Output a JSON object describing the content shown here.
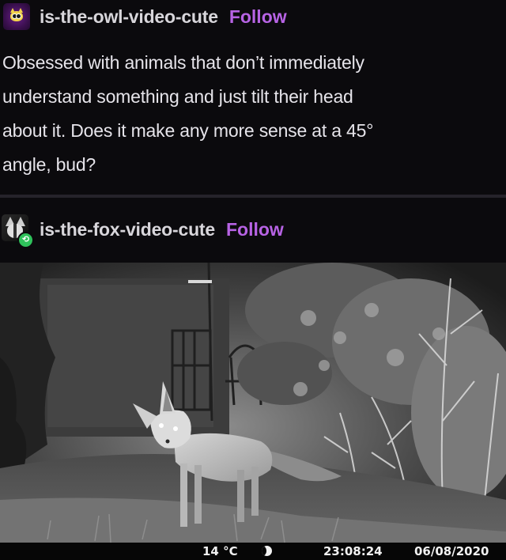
{
  "post1": {
    "blog_name": "is-the-owl-video-cute",
    "follow_label": "Follow",
    "avatar_icon": "owl-avatar-icon",
    "body_lines": [
      "Obsessed with animals that don’t immediately",
      "understand something and just tilt their head",
      "about it. Does it make any more sense at a 45°",
      "angle, bud?"
    ]
  },
  "post2": {
    "blog_name": "is-the-fox-video-cute",
    "follow_label": "Follow",
    "avatar_icon": "fox-avatar-icon",
    "badge_icon": "reblog-icon"
  },
  "photo": {
    "temperature": "14 °C",
    "moon_icon": "moon-phase-icon",
    "time": "23:08:24",
    "date": "06/08/2020"
  },
  "colors": {
    "background": "#0b0a0d",
    "follow": "#b763e4",
    "text": "#e6e4ea",
    "reblog_badge": "#2fc25b"
  }
}
